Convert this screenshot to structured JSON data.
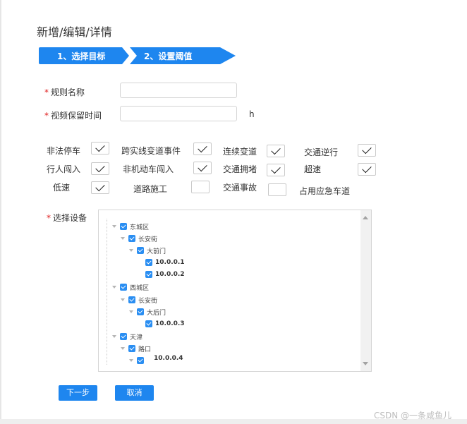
{
  "page_title": "新增/编辑/详情",
  "steps": [
    "1、选择目标",
    "2、设置阈值"
  ],
  "form": {
    "rule_name_label": "规则名称",
    "rule_name_value": "",
    "video_keep_label": "视频保留时间",
    "video_keep_value": "",
    "video_keep_unit": "h",
    "device_label": "选择设备",
    "required_mark": "*"
  },
  "events": [
    {
      "label": "非法停车",
      "checked": true
    },
    {
      "label": "跨实线变道事件",
      "checked": true
    },
    {
      "label": "连续变道",
      "checked": true
    },
    {
      "label": "交通逆行",
      "checked": true
    },
    {
      "label": "行人闯入",
      "checked": true
    },
    {
      "label": "非机动车闯入",
      "checked": true
    },
    {
      "label": "交通拥堵",
      "checked": true
    },
    {
      "label": "超速",
      "checked": true
    },
    {
      "label": "低速",
      "checked": true
    },
    {
      "label": "道路施工",
      "checked": false
    },
    {
      "label": "交通事故",
      "checked": false
    },
    {
      "label": "占用应急车道",
      "checked": false
    }
  ],
  "tree": [
    {
      "label": "东城区",
      "level": 0,
      "arrow": true,
      "checked": true
    },
    {
      "label": "长安街",
      "level": 1,
      "arrow": true,
      "checked": true
    },
    {
      "label": "大前门",
      "level": 2,
      "arrow": true,
      "checked": true
    },
    {
      "label": "10.0.0.1",
      "level": 3,
      "arrow": false,
      "checked": true
    },
    {
      "label": "10.0.0.2",
      "level": 3,
      "arrow": false,
      "checked": true
    },
    {
      "label": "西城区",
      "level": 0,
      "arrow": true,
      "checked": true
    },
    {
      "label": "长安街",
      "level": 1,
      "arrow": true,
      "checked": true
    },
    {
      "label": "大后门",
      "level": 2,
      "arrow": true,
      "checked": true
    },
    {
      "label": "10.0.0.3",
      "level": 3,
      "arrow": false,
      "checked": true
    },
    {
      "label": "天津",
      "level": 0,
      "arrow": true,
      "checked": true
    },
    {
      "label": "路口",
      "level": 1,
      "arrow": true,
      "checked": true
    },
    {
      "label": "",
      "level": 2,
      "arrow": true,
      "checked": true
    },
    {
      "label": "10.0.0.4",
      "level": 3,
      "arrow": false,
      "checked": false
    }
  ],
  "buttons": {
    "next": "下一步",
    "cancel": "取消"
  },
  "watermark": "CSDN @一条咸鱼儿"
}
